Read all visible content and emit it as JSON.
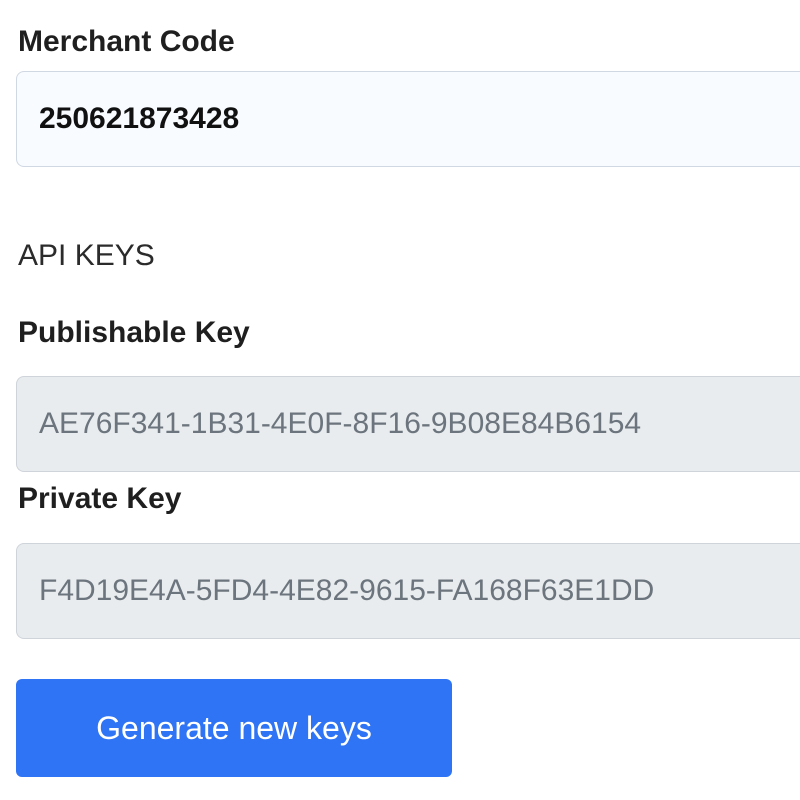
{
  "merchant": {
    "label": "Merchant Code",
    "value": "250621873428"
  },
  "api_keys": {
    "heading": "API KEYS",
    "publishable": {
      "label": "Publishable Key",
      "value": "AE76F341-1B31-4E0F-8F16-9B08E84B6154"
    },
    "private": {
      "label": "Private Key",
      "value": "F4D19E4A-5FD4-4E82-9615-FA168F63E1DD"
    },
    "generate_button_label": "Generate new keys"
  },
  "colors": {
    "primary_button": "#2f74f5",
    "readonly_field_bg": "#e9ecef",
    "editable_field_bg": "#f8fbff",
    "readonly_text": "#6c757d"
  }
}
